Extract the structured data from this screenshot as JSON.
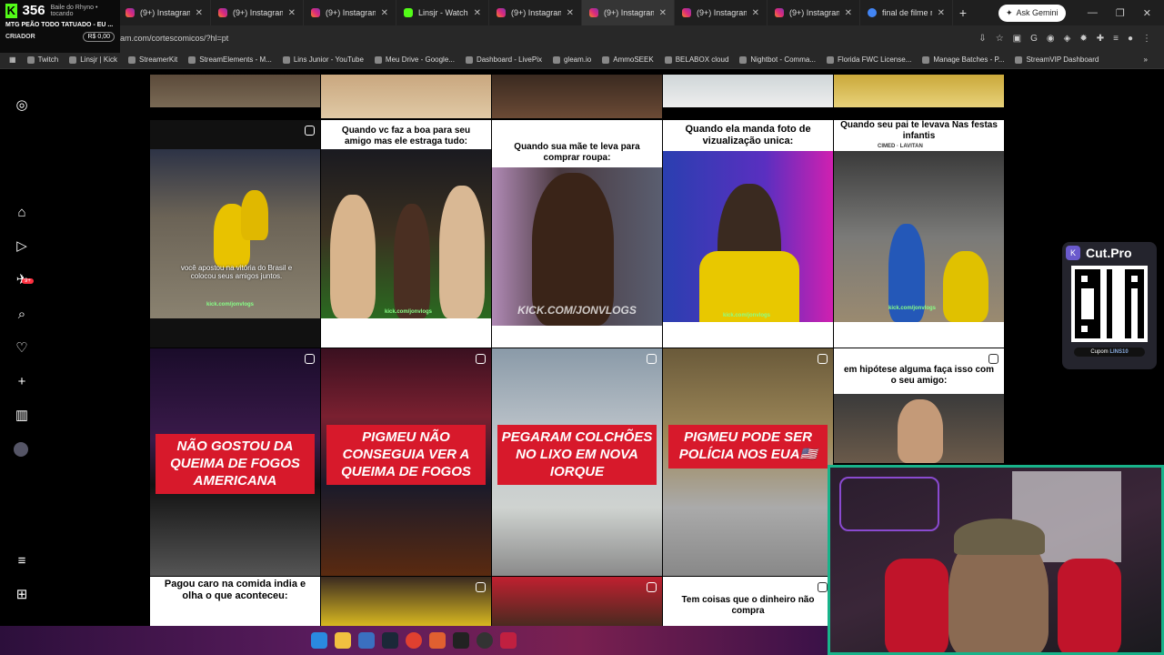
{
  "tabs": [
    {
      "label": "(9+) Instagram",
      "kind": "ig"
    },
    {
      "label": "(9+) Instagram",
      "kind": "ig"
    },
    {
      "label": "(9+) Instagram",
      "kind": "ig"
    },
    {
      "label": "Linsjr - Watch o",
      "kind": "kick"
    },
    {
      "label": "(9+) Instagram",
      "kind": "ig"
    },
    {
      "label": "(9+) Instagram",
      "kind": "ig"
    },
    {
      "label": "(9+) Instagram",
      "kind": "ig"
    },
    {
      "label": "(9+) Instagram",
      "kind": "ig"
    },
    {
      "label": "final de filme n",
      "kind": "g"
    }
  ],
  "gemini_label": "Ask Gemini",
  "kick_overlay": {
    "viewers": "356",
    "song": "Baile do Rhyno",
    "playing": "tocando",
    "title": "MTG PEÃO TODO TATUADO - EU ...",
    "creator": "CRIADOR",
    "balance": "R$ 0,00"
  },
  "url": "am.com/cortescomicos/?hl=pt",
  "bookmarks": [
    "Twitch",
    "Linsjr | Kick",
    "StreamerKit",
    "StreamElements - M...",
    "Lins Junior - YouTube",
    "Meu Drive - Google...",
    "Dashboard - LivePix",
    "gleam.io",
    "AmmoSEEK",
    "BELABOX cloud",
    "Nightbot - Comma...",
    "Florida FWC License...",
    "Manage Batches - P...",
    "StreamVIP Dashboard"
  ],
  "sidebar": {
    "notif_badge": "9+"
  },
  "posts": {
    "r1c2_caption": "Quando vc faz a boa para seu amigo mas ele estraga tudo:",
    "r1c3_caption": "Quando sua mãe te leva para comprar roupa:",
    "r1c4_caption": "Quando ela manda foto de vizualização unica:",
    "r1c5_caption": "Quando seu pai te levava Nas festas infantis",
    "r1c1_sub": "você apostou na vitória do Brasil e colocou seus amigos juntos.",
    "r1c3_wm": "KICK.COM/JONVLOGS",
    "r2c1_red": "NÃO GOSTOU DA QUEIMA DE FOGOS AMERICANA",
    "r2c2_red": "PIGMEU NÃO CONSEGUIA VER A QUEIMA DE FOGOS",
    "r2c3_red": "PEGARAM COLCHÕES NO LIXO EM NOVA IORQUE",
    "r2c4_red": "PIGMEU PODE SER POLÍCIA NOS EUA🇺🇸",
    "r2c5_caption": "em hipótese alguma faça isso com o seu amigo:",
    "r3c1_caption": "Pagou caro na comida india e olha o que aconteceu:",
    "r3c4_caption": "Tem coisas que o dinheiro não compra",
    "watermark": "kick.com/jonvlogs",
    "sponsor": "CIMED · LAVITAN"
  },
  "cutpro": {
    "name": "Cut.Pro",
    "coupon_label": "Cupom",
    "coupon_code": "LINS10"
  }
}
